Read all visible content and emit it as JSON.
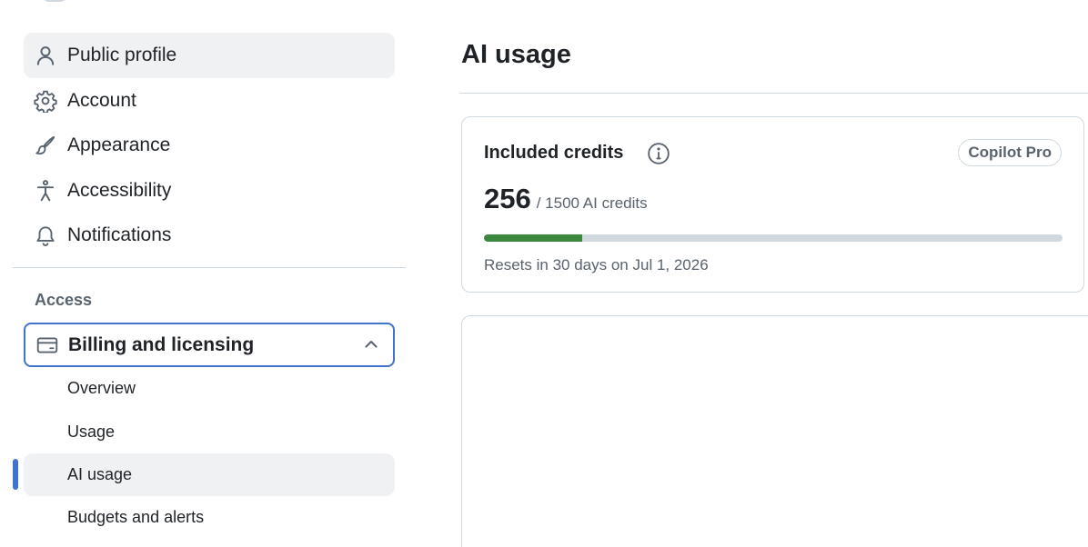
{
  "sidebar": {
    "items": [
      {
        "label": "Public profile",
        "icon": "person-icon",
        "selected": true
      },
      {
        "label": "Account",
        "icon": "gear-icon"
      },
      {
        "label": "Appearance",
        "icon": "paintbrush-icon"
      },
      {
        "label": "Accessibility",
        "icon": "accessibility-icon"
      },
      {
        "label": "Notifications",
        "icon": "bell-icon"
      }
    ],
    "section_heading": "Access",
    "billing": {
      "label": "Billing and licensing",
      "icon": "credit-card-icon",
      "expanded": true,
      "sub_items": [
        {
          "label": "Overview"
        },
        {
          "label": "Usage"
        },
        {
          "label": "AI usage",
          "selected": true
        },
        {
          "label": "Budgets and alerts"
        }
      ]
    }
  },
  "main": {
    "title": "AI usage",
    "card": {
      "title": "Included credits",
      "plan_badge": "Copilot Pro",
      "credits_used": "256",
      "credits_total": "/ 1500 AI credits",
      "progress_fraction": 0.17,
      "reset_text": "Resets in 30 days on Jul 1, 2026"
    }
  },
  "colors": {
    "accent": "#3f74c8",
    "progress": "#3b873e",
    "selected_bg": "#eff1f3",
    "border": "#d1d9e0",
    "muted_text": "#59636e"
  }
}
